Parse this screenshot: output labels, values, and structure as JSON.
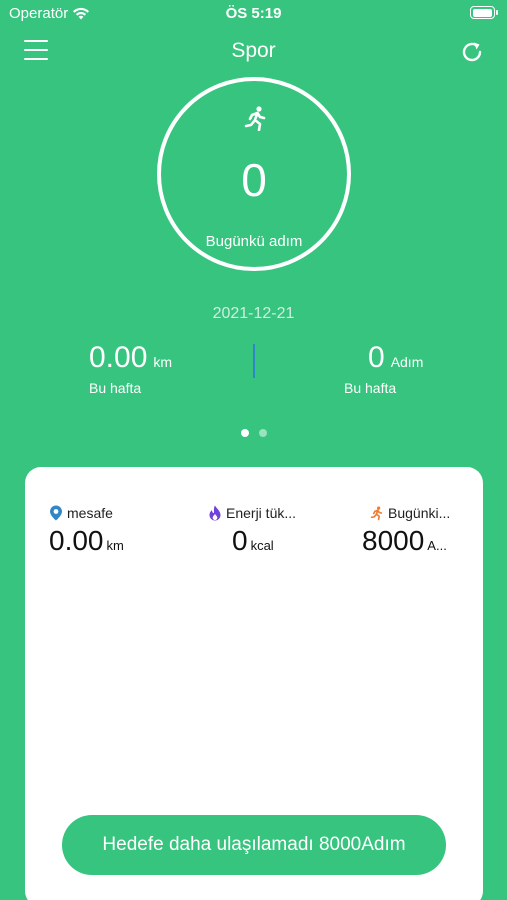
{
  "status_bar": {
    "carrier": "Operatör",
    "time": "ÖS 5:19"
  },
  "nav": {
    "title": "Spor",
    "menu_icon": "hamburger-menu-icon",
    "refresh_icon": "refresh-icon"
  },
  "today": {
    "icon": "running-person-icon",
    "steps": "0",
    "label": "Bugünkü adım"
  },
  "date": "2021-12-21",
  "week": {
    "distance": {
      "value": "0.00",
      "unit": "km",
      "caption": "Bu hafta"
    },
    "steps": {
      "value": "0",
      "unit": "Adım",
      "caption": "Bu hafta"
    }
  },
  "pager": {
    "pages": 2,
    "active": 1
  },
  "card": {
    "metrics": [
      {
        "icon": "location-pin-icon",
        "label": "mesafe",
        "value": "0.00",
        "unit": "km",
        "icon_color": "#2f86c8"
      },
      {
        "icon": "flame-icon",
        "label": "Enerji tük...",
        "value": "0",
        "unit": "kcal",
        "icon_color": "#6f42d9"
      },
      {
        "icon": "running-person-icon",
        "label": "Bugünki...",
        "value": "8000",
        "unit": "A...",
        "icon_color": "#f07b2e"
      }
    ],
    "goal_button": "Hedefe daha ulaşılamadı 8000Adım"
  },
  "colors": {
    "primary": "#36c47f",
    "card": "#ffffff",
    "divider": "#2f86c8"
  }
}
